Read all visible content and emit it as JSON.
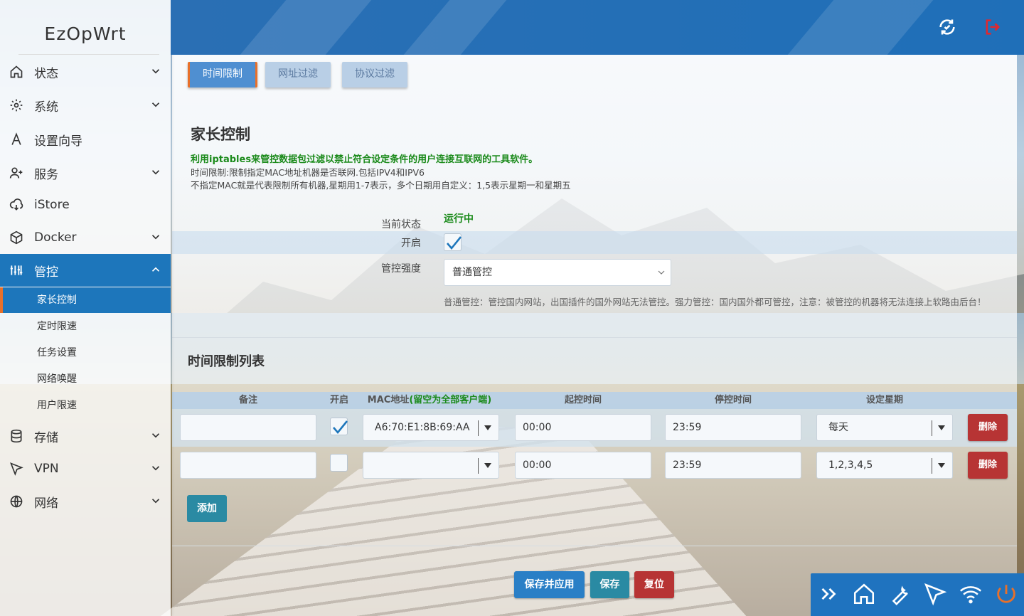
{
  "app": {
    "brand": "EzOpWrt"
  },
  "sidebar": {
    "items": [
      {
        "label": "状态",
        "icon": "home-icon",
        "expandable": true
      },
      {
        "label": "系统",
        "icon": "gear-icon",
        "expandable": true
      },
      {
        "label": "设置向导",
        "icon": "wizard-icon",
        "expandable": false
      },
      {
        "label": "服务",
        "icon": "user-plus-icon",
        "expandable": true
      },
      {
        "label": "iStore",
        "icon": "cloud-download-icon",
        "expandable": false
      },
      {
        "label": "Docker",
        "icon": "box-icon",
        "expandable": true
      },
      {
        "label": "管控",
        "icon": "sliders-icon",
        "expandable": true,
        "active": true
      },
      {
        "label": "存储",
        "icon": "database-icon",
        "expandable": true
      },
      {
        "label": "VPN",
        "icon": "send-icon",
        "expandable": true
      },
      {
        "label": "网络",
        "icon": "globe-icon",
        "expandable": true
      }
    ],
    "sub_items": [
      {
        "label": "家长控制",
        "active": true
      },
      {
        "label": "定时限速"
      },
      {
        "label": "任务设置"
      },
      {
        "label": "网络唤醒"
      },
      {
        "label": "用户限速"
      }
    ]
  },
  "header": {
    "icons": [
      "refresh-icon",
      "logout-icon"
    ],
    "accent": "#1f6fb8"
  },
  "tabs": [
    {
      "label": "时间限制",
      "active": true
    },
    {
      "label": "网址过滤"
    },
    {
      "label": "协议过滤"
    }
  ],
  "page": {
    "title": "家长控制",
    "description_bold": "利用iptables来管控数据包过滤以禁止符合设定条件的用户连接互联网的工具软件。",
    "description_line2": "时间限制:限制指定MAC地址机器是否联网.包括IPV4和IPV6",
    "description_line3": "不指定MAC就是代表限制所有机器,星期用1-7表示，多个日期用自定义：1,5表示星期一和星期五"
  },
  "settings": {
    "status_label": "当前状态",
    "status_value": "运行中",
    "enable_label": "开启",
    "enable_checked": true,
    "strength_label": "管控强度",
    "strength_value": "普通管控",
    "strength_hint": "普通管控：管控国内网站，出国插件的国外网站无法管控。强力管控：国内国外都可管控，注意：被管控的机器将无法连接上软路由后台！"
  },
  "list": {
    "title": "时间限制列表",
    "columns": {
      "remark": "备注",
      "enable": "开启",
      "mac": "MAC地址",
      "mac_note": "(留空为全部客户端)",
      "start": "起控时间",
      "stop": "停控时间",
      "weekday": "设定星期"
    },
    "rows": [
      {
        "remark": "",
        "enabled": true,
        "mac": "A6:70:E1:8B:69:AA",
        "start": "00:00",
        "stop": "23:59",
        "weekday": "每天",
        "delete_label": "删除"
      },
      {
        "remark": "",
        "enabled": false,
        "mac": "",
        "start": "00:00",
        "stop": "23:59",
        "weekday": "1,2,3,4,5",
        "delete_label": "删除"
      }
    ],
    "add_label": "添加"
  },
  "actions": {
    "save_apply": "保存并应用",
    "save": "保存",
    "reset": "复位"
  },
  "dock": {
    "icons": [
      "double-chevron-right-icon",
      "home-icon",
      "wrench-icon",
      "send-icon",
      "wifi-icon",
      "power-icon"
    ]
  },
  "colors": {
    "primary": "#1d76bb",
    "success": "#1a8a1a",
    "danger": "#b73434",
    "info": "#2a8aa3",
    "tab_accent": "#e8702a",
    "power": "#e8702a"
  }
}
